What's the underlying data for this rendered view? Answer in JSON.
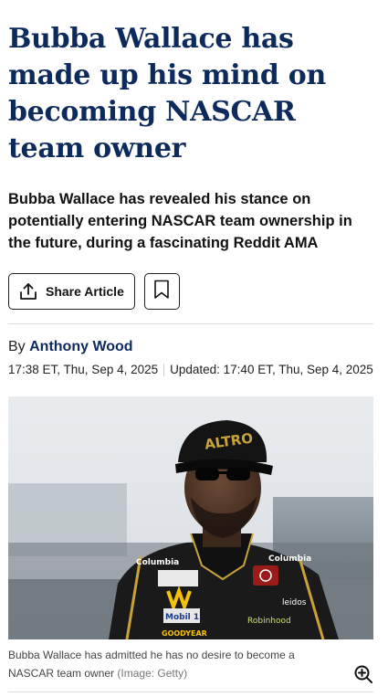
{
  "article": {
    "headline": "Bubba Wallace has made up his mind on becoming NASCAR team owner",
    "standfirst": "Bubba Wallace has revealed his stance on potentially entering NASCAR team ownership in the future, during a fascinating Reddit AMA"
  },
  "actions": {
    "share_label": "Share Article",
    "share_icon": "share-upload-icon",
    "bookmark_icon": "bookmark-icon"
  },
  "byline": {
    "prefix": "By",
    "author": "Anthony Wood",
    "published": "17:38 ET, Thu, Sep 4, 2025",
    "updated": "Updated: 17:40 ET, Thu, Sep 4, 2025"
  },
  "hero": {
    "caption": "Bubba Wallace has admitted he has no desire to become a NASCAR team owner",
    "credit": "(Image: Getty)",
    "zoom_icon": "zoom-in-icon",
    "cap_text": "ALTRO",
    "suit_logos": [
      "Columbia",
      "Columbia",
      "Mobil 1",
      "GOODYEAR",
      "Robinhood",
      "leidos"
    ]
  },
  "colors": {
    "headline": "#0d2a5c",
    "author": "#0d2a5c",
    "divider": "#dcdcdc",
    "suit": "#1a1a1a",
    "suit_accent": "#c9a23a"
  }
}
